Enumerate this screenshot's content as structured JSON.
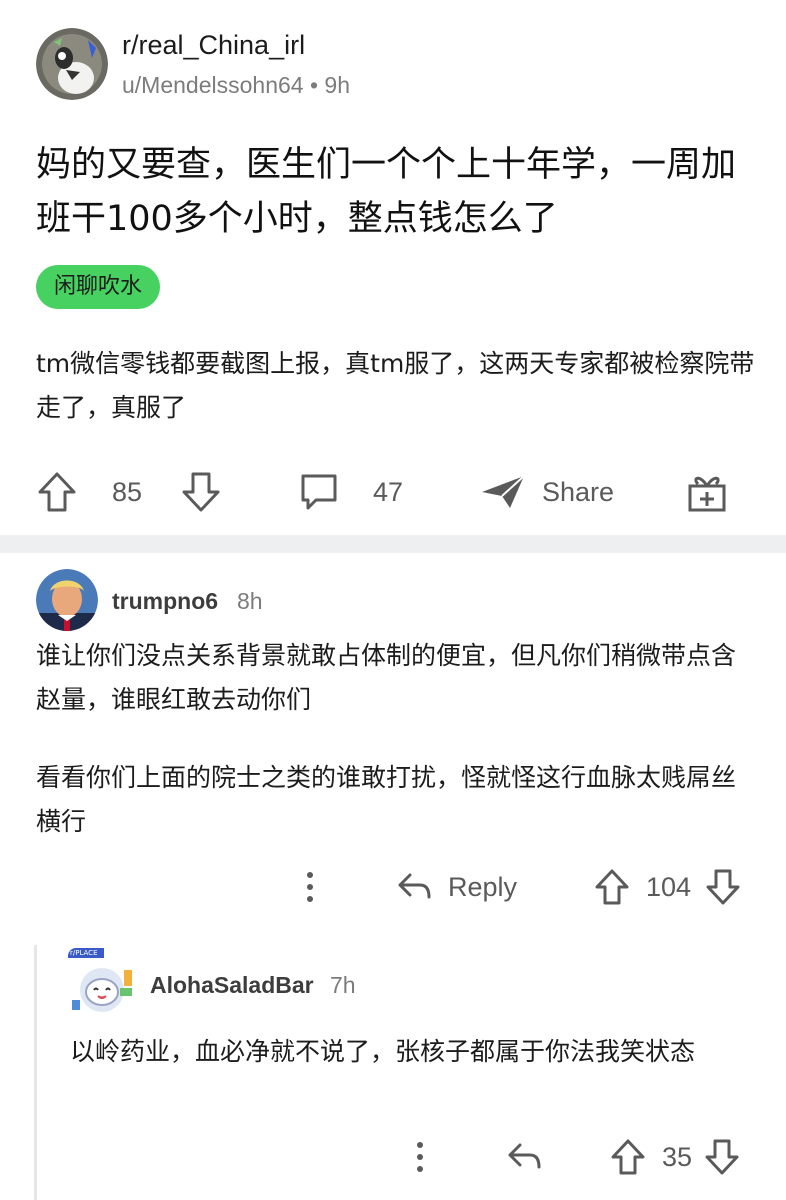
{
  "post": {
    "subreddit": "r/real_China_irl",
    "author": "u/Mendelssohn64",
    "separator": "•",
    "age": "9h",
    "title": "妈的又要查，医生们一个个上十年学，一周加班干100多个小时，整点钱怎么了",
    "flair": "闲聊吹水",
    "body": "tm微信零钱都要截图上报，真tm服了，这两天专家都被检察院带走了，真服了",
    "upvotes": "85",
    "comments": "47",
    "share_label": "Share",
    "colors": {
      "flair_bg": "#46d160",
      "divider": "#edeff1"
    }
  },
  "comments": [
    {
      "user": "trumpno6",
      "age": "8h",
      "paragraphs": [
        "谁让你们没点关系背景就敢占体制的便宜，但凡你们稍微带点含赵量，谁眼红敢去动你们",
        "看看你们上面的院士之类的谁敢打扰，怪就怪这行血脉太贱屌丝横行"
      ],
      "reply_label": "Reply",
      "score": "104"
    },
    {
      "user": "AlohaSaladBar",
      "age": "7h",
      "avatar_badge": "r/PLACE",
      "paragraphs": [
        "以岭药业，血必净就不说了，张核子都属于你法我笑状态"
      ],
      "score": "35"
    }
  ],
  "icons": {
    "upvote": "arrow-up-icon",
    "downvote": "arrow-down-icon",
    "comment": "speech-bubble-icon",
    "share": "paper-plane-icon",
    "award": "gift-icon",
    "more": "vertical-dots-icon",
    "reply": "reply-arrow-icon"
  }
}
